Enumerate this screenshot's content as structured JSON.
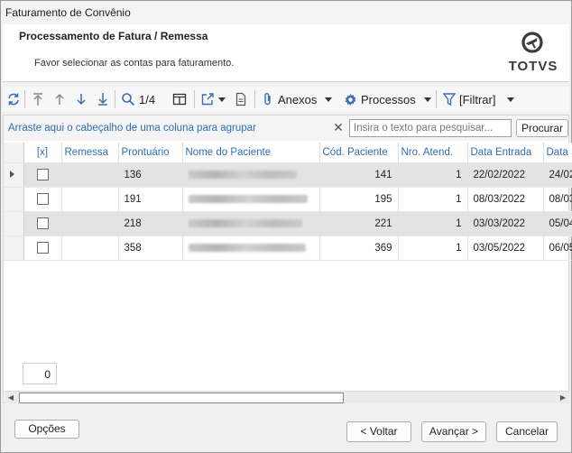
{
  "window": {
    "title": "Faturamento de Convênio"
  },
  "header": {
    "title": "Processamento de Fatura / Remessa",
    "subtitle": "Favor selecionar as contas para faturamento.",
    "logo_text": "TOTVS"
  },
  "toolbar": {
    "page_indicator": "1/4",
    "anexos": "Anexos",
    "processos": "Processos",
    "filtrar": "[Filtrar]"
  },
  "groupbar": {
    "hint": "Arraste aqui o cabeçalho de uma coluna para agrupar",
    "search_placeholder": "Insira o texto para pesquisar...",
    "search_button": "Procurar"
  },
  "grid": {
    "columns": [
      "[x]",
      "Remessa",
      "Prontuário",
      "Nome do Paciente",
      "Cód. Paciente",
      "Nro. Atend.",
      "Data Entrada",
      "Data S"
    ],
    "rows": [
      {
        "prontuario": "136",
        "cod_paciente": "141",
        "nro_atend": "1",
        "data_entrada": "22/02/2022",
        "data_s": "24/02"
      },
      {
        "prontuario": "191",
        "cod_paciente": "195",
        "nro_atend": "1",
        "data_entrada": "08/03/2022",
        "data_s": "08/03"
      },
      {
        "prontuario": "218",
        "cod_paciente": "221",
        "nro_atend": "1",
        "data_entrada": "03/03/2022",
        "data_s": "05/04"
      },
      {
        "prontuario": "358",
        "cod_paciente": "369",
        "nro_atend": "1",
        "data_entrada": "03/05/2022",
        "data_s": "06/05"
      }
    ],
    "selected_count": "0"
  },
  "footer": {
    "options": "Opções",
    "back": "< Voltar",
    "next": "Avançar >",
    "cancel": "Cancelar"
  },
  "icons": [
    "refresh-icon",
    "move-first-icon",
    "move-up-icon",
    "move-down-icon",
    "move-last-icon",
    "search-icon",
    "columns-icon",
    "export-icon",
    "document-icon",
    "paperclip-icon",
    "gear-icon",
    "filter-icon"
  ],
  "colors": {
    "accent": "#2e6db4",
    "row_shade": "#e3e3e3"
  }
}
